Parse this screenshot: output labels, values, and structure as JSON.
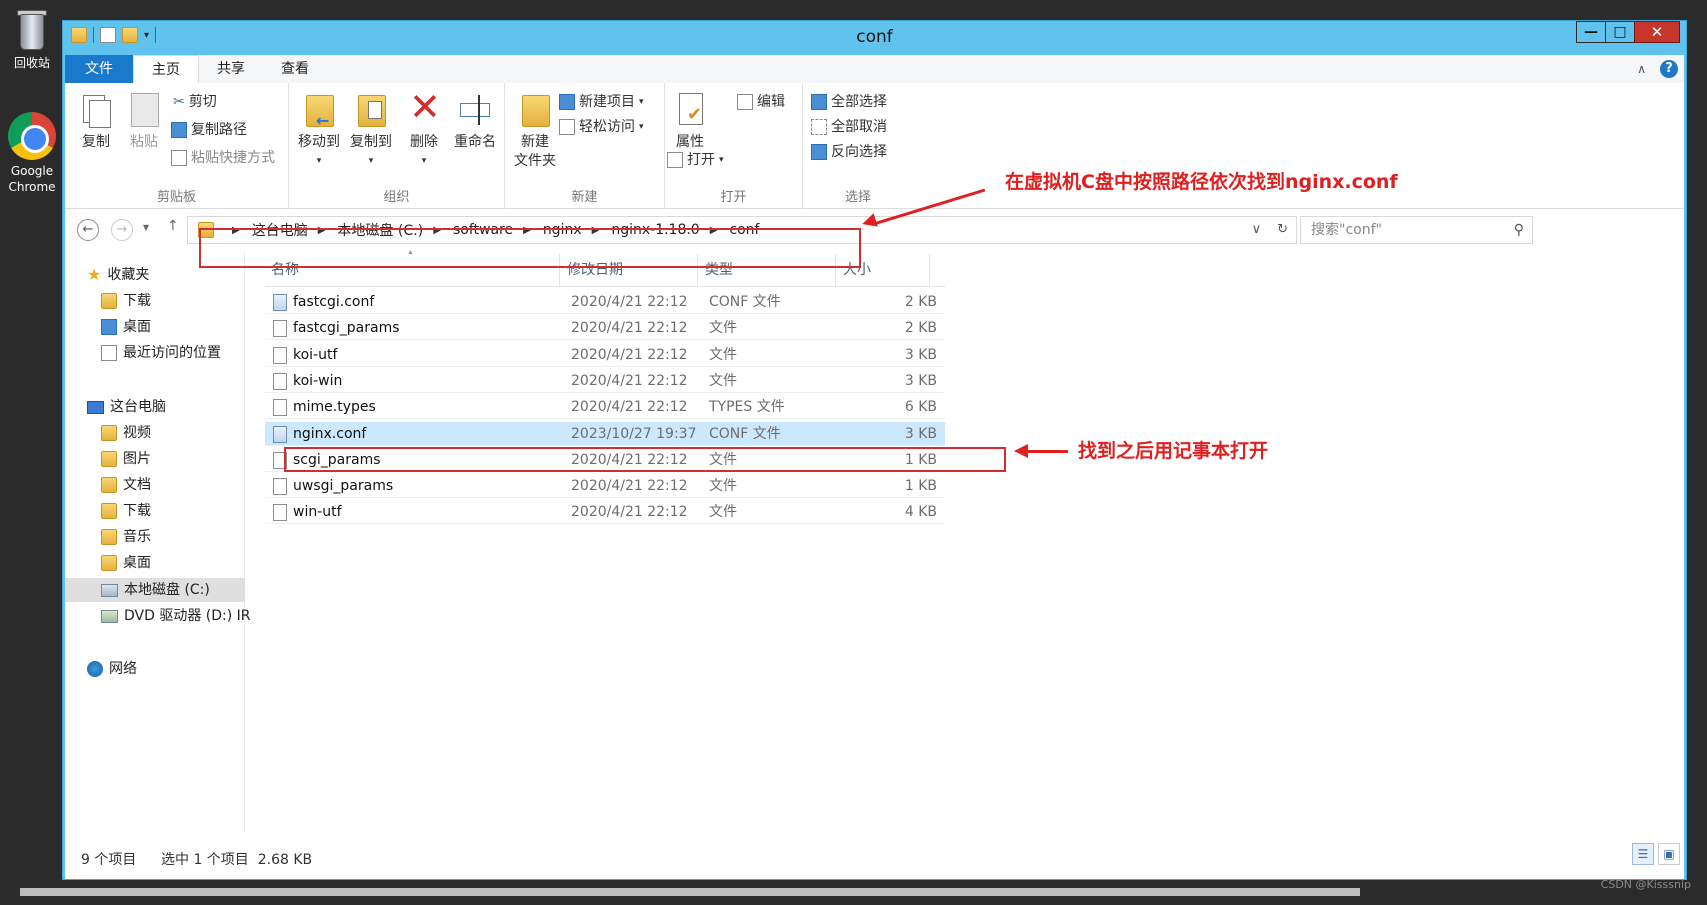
{
  "desktop": {
    "recycle_bin_label": "回收站",
    "chrome_label": "Google Chrome"
  },
  "window": {
    "title": "conf",
    "controls": {
      "minimize": "—",
      "maximize": "□",
      "close": "✕"
    }
  },
  "menu_tabs": [
    "文件",
    "主页",
    "共享",
    "查看"
  ],
  "ribbon": {
    "clipboard": {
      "label": "剪贴板",
      "copy": "复制",
      "paste": "粘贴",
      "cut": "剪切",
      "copy_path": "复制路径",
      "paste_shortcut": "粘贴快捷方式"
    },
    "organize": {
      "label": "组织",
      "move_to": "移动到",
      "copy_to": "复制到",
      "delete": "删除",
      "rename": "重命名"
    },
    "new": {
      "label": "新建",
      "new_folder_line1": "新建",
      "new_folder_line2": "文件夹",
      "new_item": "新建项目",
      "easy_access": "轻松访问"
    },
    "open": {
      "label": "打开",
      "properties": "属性",
      "open": "打开",
      "edit": "编辑"
    },
    "select": {
      "label": "选择",
      "select_all": "全部选择",
      "select_none": "全部取消",
      "invert": "反向选择"
    }
  },
  "address": {
    "crumbs": [
      "这台电脑",
      "本地磁盘 (C:)",
      "software",
      "nginx",
      "nginx-1.18.0",
      "conf"
    ],
    "search_placeholder": "搜索\"conf\""
  },
  "nav_pane": {
    "favorites": "收藏夹",
    "favorites_items": [
      "下载",
      "桌面",
      "最近访问的位置"
    ],
    "this_pc": "这台电脑",
    "pc_items": [
      "视频",
      "图片",
      "文档",
      "下载",
      "音乐",
      "桌面"
    ],
    "local_disk": "本地磁盘 (C:)",
    "dvd": "DVD 驱动器 (D:) IR",
    "network": "网络"
  },
  "columns": [
    "名称",
    "修改日期",
    "类型",
    "大小"
  ],
  "files": [
    {
      "name": "fastcgi.conf",
      "date": "2020/4/21 22:12",
      "type": "CONF 文件",
      "size": "2 KB",
      "icon": "conf-file-icon"
    },
    {
      "name": "fastcgi_params",
      "date": "2020/4/21 22:12",
      "type": "文件",
      "size": "2 KB",
      "icon": "file-icon"
    },
    {
      "name": "koi-utf",
      "date": "2020/4/21 22:12",
      "type": "文件",
      "size": "3 KB",
      "icon": "file-icon"
    },
    {
      "name": "koi-win",
      "date": "2020/4/21 22:12",
      "type": "文件",
      "size": "3 KB",
      "icon": "file-icon"
    },
    {
      "name": "mime.types",
      "date": "2020/4/21 22:12",
      "type": "TYPES 文件",
      "size": "6 KB",
      "icon": "file-icon"
    },
    {
      "name": "nginx.conf",
      "date": "2023/10/27 19:37",
      "type": "CONF 文件",
      "size": "3 KB",
      "icon": "conf-file-icon",
      "selected": true
    },
    {
      "name": "scgi_params",
      "date": "2020/4/21 22:12",
      "type": "文件",
      "size": "1 KB",
      "icon": "file-icon"
    },
    {
      "name": "uwsgi_params",
      "date": "2020/4/21 22:12",
      "type": "文件",
      "size": "1 KB",
      "icon": "file-icon"
    },
    {
      "name": "win-utf",
      "date": "2020/4/21 22:12",
      "type": "文件",
      "size": "4 KB",
      "icon": "file-icon"
    }
  ],
  "status": {
    "item_count": "9 个项目",
    "selection": "选中 1 个项目  2.68 KB"
  },
  "annotations": {
    "path_note": "在虚拟机C盘中按照路径依次找到nginx.conf",
    "file_note": "找到之后用记事本打开"
  },
  "watermark": "CSDN @Kisssnip",
  "colors": {
    "accent": "#5fc3ee",
    "file_tab": "#1979ca",
    "annotation": "#e02020",
    "selection": "#cce8ff"
  }
}
